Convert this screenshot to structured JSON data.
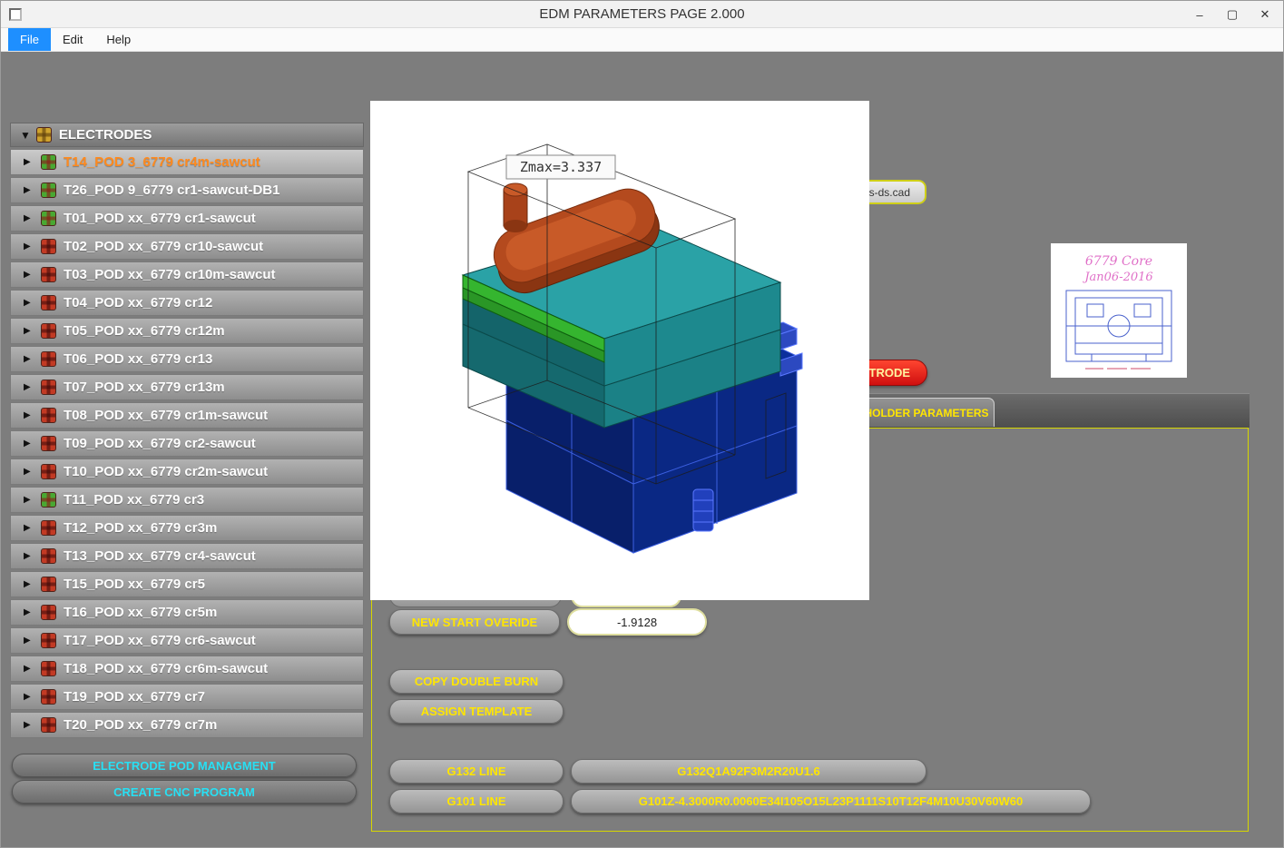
{
  "window": {
    "title": "EDM PARAMETERS PAGE 2.000",
    "controls": {
      "minimize": "–",
      "maximize": "▢",
      "close": "✕"
    }
  },
  "menubar": {
    "items": [
      {
        "label": "File",
        "active": true
      },
      {
        "label": "Edit",
        "active": false
      },
      {
        "label": "Help",
        "active": false
      }
    ]
  },
  "sidebar": {
    "header": {
      "label": "ELECTRODES"
    },
    "items": [
      {
        "label": "T14_POD 3_6779 cr4m-sawcut",
        "selected": true,
        "icon": "green"
      },
      {
        "label": "T26_POD 9_6779 cr1-sawcut-DB1",
        "selected": false,
        "icon": "green"
      },
      {
        "label": "T01_POD xx_6779 cr1-sawcut",
        "selected": false,
        "icon": "green"
      },
      {
        "label": "T02_POD xx_6779 cr10-sawcut",
        "selected": false,
        "icon": "red"
      },
      {
        "label": "T03_POD xx_6779 cr10m-sawcut",
        "selected": false,
        "icon": "red"
      },
      {
        "label": "T04_POD xx_6779 cr12",
        "selected": false,
        "icon": "red"
      },
      {
        "label": "T05_POD xx_6779 cr12m",
        "selected": false,
        "icon": "red"
      },
      {
        "label": "T06_POD xx_6779 cr13",
        "selected": false,
        "icon": "red"
      },
      {
        "label": "T07_POD xx_6779 cr13m",
        "selected": false,
        "icon": "red"
      },
      {
        "label": "T08_POD xx_6779 cr1m-sawcut",
        "selected": false,
        "icon": "red"
      },
      {
        "label": "T09_POD xx_6779 cr2-sawcut",
        "selected": false,
        "icon": "red"
      },
      {
        "label": "T10_POD xx_6779 cr2m-sawcut",
        "selected": false,
        "icon": "red"
      },
      {
        "label": "T11_POD xx_6779 cr3",
        "selected": false,
        "icon": "green"
      },
      {
        "label": "T12_POD xx_6779 cr3m",
        "selected": false,
        "icon": "red"
      },
      {
        "label": "T13_POD xx_6779 cr4-sawcut",
        "selected": false,
        "icon": "red"
      },
      {
        "label": "T15_POD xx_6779 cr5",
        "selected": false,
        "icon": "red"
      },
      {
        "label": "T16_POD xx_6779 cr5m",
        "selected": false,
        "icon": "red"
      },
      {
        "label": "T17_POD xx_6779 cr6-sawcut",
        "selected": false,
        "icon": "red"
      },
      {
        "label": "T18_POD xx_6779 cr6m-sawcut",
        "selected": false,
        "icon": "red"
      },
      {
        "label": "T19_POD xx_6779 cr7",
        "selected": false,
        "icon": "red"
      },
      {
        "label": "T20_POD xx_6779 cr7m",
        "selected": false,
        "icon": "red"
      }
    ],
    "buttons": [
      {
        "label": "ELECTRODE POD MANAGMENT"
      },
      {
        "label": "CREATE CNC PROGRAM"
      }
    ]
  },
  "viewport": {
    "zmax_annotation": "Zmax=3.337"
  },
  "right_side": {
    "cad_file_label": "s-ds.cad",
    "red_button_label": "TRODE",
    "tab_label": "HOLDER PARAMETERS",
    "thumbnail": {
      "line1": "6779 Core",
      "line2": "Jan06-2016"
    }
  },
  "parameters": {
    "new_start_override": {
      "label": "NEW START OVERIDE",
      "value": "-1.9128"
    },
    "copy_double_burn_label": "COPY DOUBLE BURN",
    "assign_template_label": "ASSIGN TEMPLATE",
    "g132": {
      "label": "G132 LINE",
      "value": "G132Q1A92F3M2R20U1.6"
    },
    "g101": {
      "label": "G101 LINE",
      "value": "G101Z-4.3000R0.0060E34I105O15L23P1111S10T12F4M10U30V60W60"
    }
  },
  "colors": {
    "accent_yellow": "#ffe600",
    "accent_cyan": "#27e0f4",
    "selected_orange": "#ff8a1e",
    "menu_highlight": "#1e8fff",
    "red_button": "#e31b12",
    "panel_border": "#d6d600"
  }
}
